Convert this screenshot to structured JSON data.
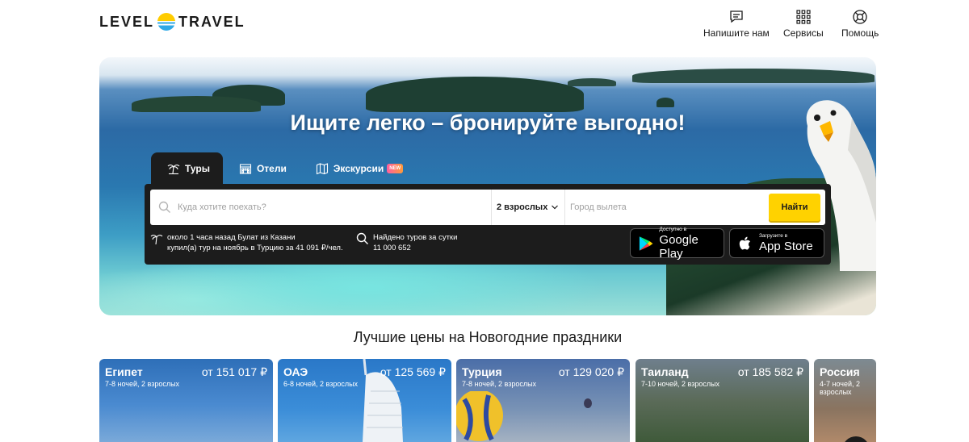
{
  "header": {
    "logo_left": "LEVEL",
    "logo_right": "TRAVEL",
    "nav": [
      {
        "label": "Напишите нам",
        "icon": "chat-icon"
      },
      {
        "label": "Сервисы",
        "icon": "grid-icon"
      },
      {
        "label": "Помощь",
        "icon": "lifebuoy-icon"
      }
    ]
  },
  "hero": {
    "title": "Ищите легко – бронируйте выгодно!",
    "tabs": [
      {
        "label": "Туры",
        "icon": "palm-icon",
        "active": true
      },
      {
        "label": "Отели",
        "icon": "hotel-icon",
        "active": false
      },
      {
        "label": "Экскурсии",
        "icon": "map-icon",
        "active": false,
        "badge": "NEW"
      }
    ],
    "search": {
      "destination_placeholder": "Куда хотите поехать?",
      "travelers": "2 взрослых",
      "departure_placeholder": "Город вылета",
      "submit": "Найти"
    },
    "recent_booking": {
      "line1": "около 1 часа назад Булат из Казани",
      "line2": "купил(а) тур на ноябрь в Турцию за 41 091 ₽/чел."
    },
    "tours_found": {
      "line1": "Найдено туров за сутки",
      "line2": "11 000 652"
    },
    "stores": {
      "google": {
        "small": "Доступно в",
        "big": "Google Play"
      },
      "apple": {
        "small": "Загрузите в",
        "big": "App Store"
      }
    }
  },
  "section": {
    "title": "Лучшие цены на Новогодние праздники",
    "cards": [
      {
        "name": "Египет",
        "meta": "7-8 ночей, 2 взрослых",
        "price": "от 151 017 ₽"
      },
      {
        "name": "ОАЭ",
        "meta": "6-8 ночей, 2 взрослых",
        "price": "от 125 569 ₽"
      },
      {
        "name": "Турция",
        "meta": "7-8 ночей, 2 взрослых",
        "price": "от 129 020 ₽"
      },
      {
        "name": "Таиланд",
        "meta": "7-10 ночей, 2 взрослых",
        "price": "от 185 582 ₽"
      },
      {
        "name": "Россия",
        "meta": "4-7 ночей, 2 взрослых",
        "price": ""
      }
    ]
  },
  "colors": {
    "accent_yellow": "#ffd200",
    "panel_dark": "#1c1c1c",
    "badge_gradient": [
      "#ff5fa0",
      "#ff9b3a"
    ]
  }
}
